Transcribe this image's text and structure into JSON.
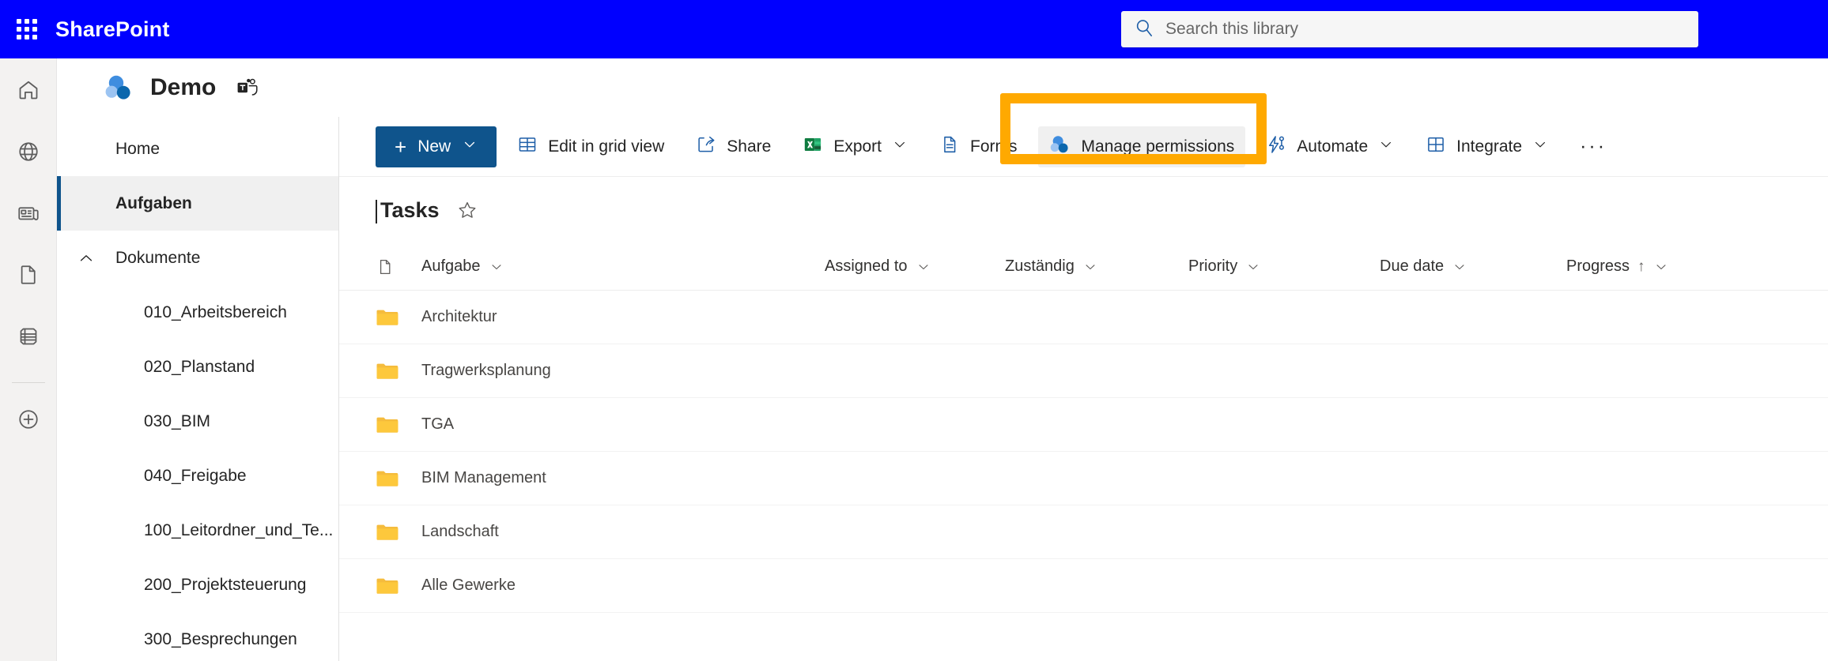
{
  "suite": {
    "waffle_label": "app-launcher",
    "brand": "SharePoint"
  },
  "search": {
    "placeholder": "Search this library",
    "value": "",
    "icon": "search-icon"
  },
  "rail": {
    "items": [
      {
        "icon": "home-icon",
        "label": "Home"
      },
      {
        "icon": "globe-icon",
        "label": "My sites"
      },
      {
        "icon": "news-icon",
        "label": "News"
      },
      {
        "icon": "document-icon",
        "label": "Files"
      },
      {
        "icon": "list-icon",
        "label": "Lists"
      },
      {
        "icon": "plus-circle-icon",
        "label": "Create"
      }
    ]
  },
  "site": {
    "logo_icon": "sharepoint-site-logo",
    "title": "Demo",
    "teams_icon": "teams-icon"
  },
  "leftnav": {
    "items": [
      {
        "label": "Home",
        "type": "item",
        "selected": false
      },
      {
        "label": "Aufgaben",
        "type": "item",
        "selected": true
      },
      {
        "label": "Dokumente",
        "type": "group",
        "expanded": true
      },
      {
        "label": "010_Arbeitsbereich",
        "type": "child"
      },
      {
        "label": "020_Planstand",
        "type": "child"
      },
      {
        "label": "030_BIM",
        "type": "child"
      },
      {
        "label": "040_Freigabe",
        "type": "child"
      },
      {
        "label": "100_Leitordner_und_Te...",
        "type": "child"
      },
      {
        "label": "200_Projektsteuerung",
        "type": "child"
      },
      {
        "label": "300_Besprechungen",
        "type": "child"
      }
    ]
  },
  "commandbar": {
    "new_label": "New",
    "new_plus": "+",
    "items": [
      {
        "label": "Edit in grid view",
        "icon": "grid-icon",
        "chevron": false
      },
      {
        "label": "Share",
        "icon": "share-icon",
        "chevron": false
      },
      {
        "label": "Export",
        "icon": "excel-icon",
        "chevron": true
      },
      {
        "label": "Forms",
        "icon": "forms-icon",
        "chevron": false
      },
      {
        "label": "Manage permissions",
        "icon": "sharepoint-site-logo",
        "chevron": false,
        "hovered": true
      },
      {
        "label": "Automate",
        "icon": "automate-icon",
        "chevron": true
      },
      {
        "label": "Integrate",
        "icon": "integrate-icon",
        "chevron": true
      }
    ],
    "overflow_label": "···"
  },
  "list": {
    "title": "Tasks",
    "favorite_icon": "star-icon",
    "columns": [
      {
        "label": "Aufgabe",
        "sort": ""
      },
      {
        "label": "Assigned to",
        "sort": ""
      },
      {
        "label": "Zuständig",
        "sort": ""
      },
      {
        "label": "Priority",
        "sort": ""
      },
      {
        "label": "Due date",
        "sort": ""
      },
      {
        "label": "Progress",
        "sort": "↑"
      }
    ],
    "rows": [
      {
        "name": "Architektur",
        "icon": "folder-icon"
      },
      {
        "name": "Tragwerksplanung",
        "icon": "folder-icon"
      },
      {
        "name": "TGA",
        "icon": "folder-icon"
      },
      {
        "name": "BIM Management",
        "icon": "folder-icon"
      },
      {
        "name": "Landschaft",
        "icon": "folder-icon"
      },
      {
        "name": "Alle Gewerke",
        "icon": "folder-icon"
      }
    ]
  },
  "annotation": {
    "color": "#ffa900",
    "target": "Manage permissions"
  },
  "colors": {
    "suite_bar": "#0000ff",
    "accent_blue": "#0f548c",
    "folder_yellow": "#ffc котор"
  }
}
